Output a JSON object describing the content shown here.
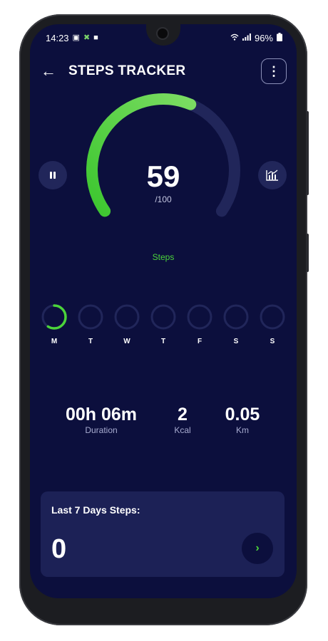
{
  "status_bar": {
    "time": "14:23",
    "battery": "96%",
    "left_icons": [
      "image-icon",
      "app-icon",
      "square-icon"
    ],
    "right_icons": [
      "wifi-icon",
      "signal-icon",
      "battery-icon"
    ]
  },
  "header": {
    "title": "STEPS TRACKER",
    "back_icon": "arrow-left-icon",
    "menu_icon": "more-vertical-icon"
  },
  "progress": {
    "steps": "59",
    "goal": "/100",
    "label": "Steps",
    "fraction": 0.59
  },
  "controls": {
    "pause_icon": "pause-icon",
    "chart_icon": "bar-chart-icon"
  },
  "week": {
    "days": [
      {
        "label": "M",
        "progress": 0.59
      },
      {
        "label": "T",
        "progress": 0
      },
      {
        "label": "W",
        "progress": 0
      },
      {
        "label": "T",
        "progress": 0
      },
      {
        "label": "F",
        "progress": 0
      },
      {
        "label": "S",
        "progress": 0
      },
      {
        "label": "S",
        "progress": 0
      }
    ]
  },
  "stats": {
    "duration": {
      "value": "00h 06m",
      "unit": "Duration"
    },
    "kcal": {
      "value": "2",
      "unit": "Kcal"
    },
    "km": {
      "value": "0.05",
      "unit": "Km"
    }
  },
  "card": {
    "title": "Last 7 Days Steps:",
    "value": "0",
    "button_icon": "chevron-right-icon"
  },
  "colors": {
    "background": "#0c0f3d",
    "accent": "#4bd43a",
    "track": "#21265a",
    "card": "#1c2156"
  }
}
